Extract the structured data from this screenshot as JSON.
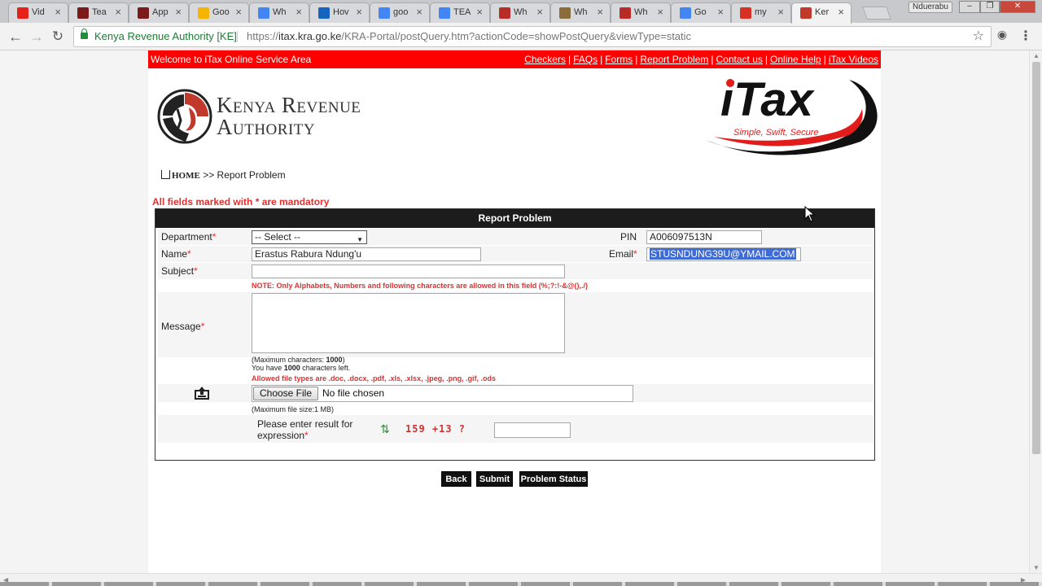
{
  "browser": {
    "tabs": [
      {
        "title": "Vid",
        "icon_color": "#e62117",
        "icon": "youtube-icon"
      },
      {
        "title": "Tea",
        "icon_color": "#7a1a1a",
        "icon": "kra-icon"
      },
      {
        "title": "App",
        "icon_color": "#7a1a1a",
        "icon": "kra-icon"
      },
      {
        "title": "Goo",
        "icon_color": "#f4b400",
        "icon": "google-drive-icon"
      },
      {
        "title": "Wh",
        "icon_color": "#4285f4",
        "icon": "google-icon"
      },
      {
        "title": "Hov",
        "icon_color": "#1565c0",
        "icon": "x-icon"
      },
      {
        "title": "goo",
        "icon_color": "#4285f4",
        "icon": "google-icon"
      },
      {
        "title": "TEA",
        "icon_color": "#4285f4",
        "icon": "google-icon"
      },
      {
        "title": "Wh",
        "icon_color": "#b92b27",
        "icon": "quora-icon"
      },
      {
        "title": "Wh",
        "icon_color": "#8a6d3b",
        "icon": "wiki-icon"
      },
      {
        "title": "Wh",
        "icon_color": "#b92b27",
        "icon": "quora-icon"
      },
      {
        "title": "Go",
        "icon_color": "#4285f4",
        "icon": "google-icon"
      },
      {
        "title": "my",
        "icon_color": "#d93025",
        "icon": "gmail-icon"
      },
      {
        "title": "Ker",
        "icon_color": "#c0392b",
        "icon": "kra-icon",
        "active": true
      }
    ],
    "user_label": "Nduerabu",
    "site_name": "Kenya Revenue Authority [KE]",
    "url_prefix": "https://",
    "url_main": "itax.kra.go.ke",
    "url_rest": "/KRA-Portal/postQuery.htm?actionCode=showPostQuery&viewType=static"
  },
  "topbar": {
    "welcome": "Welcome to iTax Online Service Area",
    "links": [
      "Checkers",
      "FAQs",
      "Forms",
      "Report Problem",
      "Contact us",
      "Online Help",
      "iTax Videos"
    ]
  },
  "header": {
    "kra_line1": "Kenya Revenue",
    "kra_line2": "Authority",
    "itax_text": "iTax",
    "itax_tagline": "Simple, Swift, Secure"
  },
  "breadcrumb": {
    "home": "HOME",
    "current": ">> Report Problem"
  },
  "mandatory_note": "All fields marked with * are mandatory",
  "form": {
    "title": "Report Problem",
    "department_label": "Department",
    "department_value": "-- Select --",
    "pin_label": "PIN",
    "pin_value": "A006097513N",
    "name_label": "Name",
    "name_value": "Erastus Rabura Ndung'u",
    "email_label": "Email",
    "email_value": "STUSNDUNG39U@YMAIL.COM",
    "subject_label": "Subject",
    "subject_value": "",
    "subject_note": "NOTE: Only Alphabets, Numbers and following characters are allowed in this field (%;?:!-&@(),./)",
    "message_label": "Message",
    "message_value": "",
    "max_chars_prefix": "(Maximum characters: ",
    "max_chars": "1000",
    "max_chars_suffix": ")",
    "chars_left_prefix": "You have ",
    "chars_left": "1000",
    "chars_left_suffix": " characters left.",
    "file_types_note": "Allowed file types are .doc, .docx, .pdf, .xls, .xlsx, .jpeg, .png, .gif, .ods",
    "choose_file_label": "Choose File",
    "no_file_text": "No file chosen",
    "max_file_size": "(Maximum file size:1 MB)",
    "captcha_label_1": "Please enter result for",
    "captcha_label_2": "expression",
    "captcha_expression": "159 +13 ?",
    "captcha_answer": ""
  },
  "buttons": {
    "back": "Back",
    "submit": "Submit",
    "status": "Problem Status"
  },
  "colors": {
    "topbar_red": "#ff0000",
    "panel_header": "#1c1c1c",
    "required_red": "#e03030",
    "selection_blue": "#3e6bd6"
  }
}
